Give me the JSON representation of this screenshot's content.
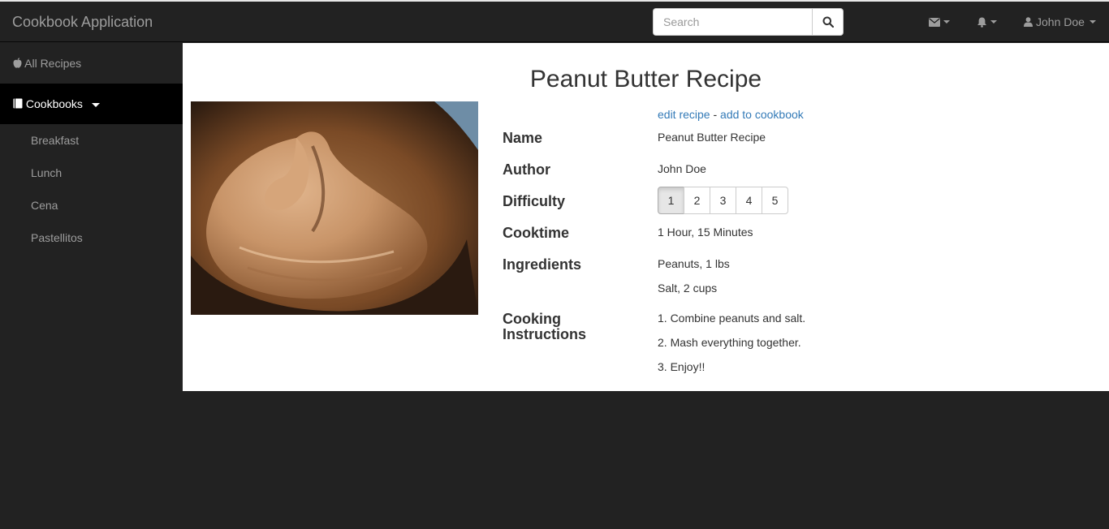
{
  "navbar": {
    "brand": "Cookbook Application",
    "search_placeholder": "Search",
    "user_name": "John Doe"
  },
  "sidebar": {
    "all_recipes": "All Recipes",
    "cookbooks": "Cookbooks",
    "cookbook_items": [
      "Breakfast",
      "Lunch",
      "Cena",
      "Pastellitos"
    ]
  },
  "recipe": {
    "page_title": "Peanut Butter Recipe",
    "edit_link": "edit recipe",
    "separator": "-",
    "add_link": "add to cookbook",
    "labels": {
      "name": "Name",
      "author": "Author",
      "difficulty": "Difficulty",
      "cooktime": "Cooktime",
      "ingredients": "Ingredients",
      "instructions_line1": "Cooking",
      "instructions_line2": "Instructions"
    },
    "name": "Peanut Butter Recipe",
    "author": "John Doe",
    "difficulty_options": [
      "1",
      "2",
      "3",
      "4",
      "5"
    ],
    "difficulty_selected": "1",
    "cooktime": "1 Hour, 15 Minutes",
    "ingredients": [
      "Peanuts, 1 lbs",
      "Salt, 2 cups"
    ],
    "instructions": [
      "1. Combine peanuts and salt.",
      "2. Mash everything together.",
      "3. Enjoy!!"
    ]
  }
}
